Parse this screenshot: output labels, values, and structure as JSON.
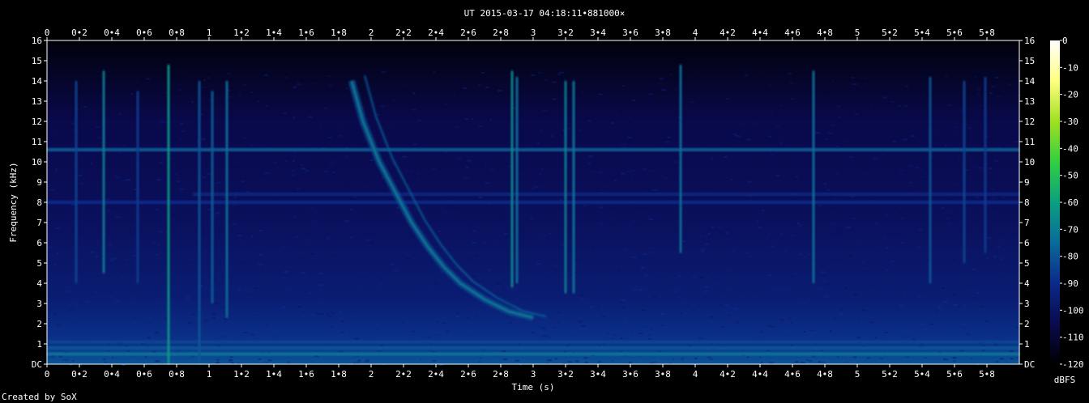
{
  "chart_data": {
    "type": "heatmap",
    "title": "UT 2015-03-17 04:18:11•881000×",
    "xlabel": "Time (s)",
    "ylabel": "Frequency (kHz)",
    "colorbar_label": "dBFS",
    "footer": "Created by SoX",
    "xlim": [
      0,
      6.0
    ],
    "ylim": [
      0,
      16
    ],
    "x_ticks": [
      "0",
      "0•2",
      "0•4",
      "0•6",
      "0•8",
      "1",
      "1•2",
      "1•4",
      "1•6",
      "1•8",
      "2",
      "2•2",
      "2•4",
      "2•6",
      "2•8",
      "3",
      "3•2",
      "3•4",
      "3•6",
      "3•8",
      "4",
      "4•2",
      "4•4",
      "4•6",
      "4•8",
      "5",
      "5•2",
      "5•4",
      "5•6",
      "5•8"
    ],
    "y_ticks": [
      "DC",
      "1",
      "2",
      "3",
      "4",
      "5",
      "6",
      "7",
      "8",
      "9",
      "10",
      "11",
      "12",
      "13",
      "14",
      "15",
      "16"
    ],
    "colorbar_ticks": [
      "0",
      "-10",
      "-20",
      "-30",
      "-40",
      "-50",
      "-60",
      "-70",
      "-80",
      "-90",
      "-100",
      "-110",
      "-120"
    ],
    "colorbar_range": [
      -120,
      0
    ],
    "colors": {
      "background": "#000000",
      "text": "#ffffff",
      "noise_floor": "#0a1a66",
      "strong": "#2fd6a8"
    },
    "colormap": [
      "#000000",
      "#0a0a50",
      "#0a2a8a",
      "#0a6a9a",
      "#0aa080",
      "#30d040",
      "#a0e020",
      "#ffff80",
      "#ffffff"
    ],
    "features": {
      "horizontal_lines": [
        {
          "freq_khz": 10.6,
          "level_db": -78,
          "t_start": 0,
          "t_end": 6
        },
        {
          "freq_khz": 8.4,
          "level_db": -92,
          "t_start": 0.9,
          "t_end": 6
        },
        {
          "freq_khz": 8.0,
          "level_db": -90,
          "t_start": 0,
          "t_end": 6
        },
        {
          "freq_khz": 0.5,
          "level_db": -72,
          "t_start": 0,
          "t_end": 6
        },
        {
          "freq_khz": 0.8,
          "level_db": -80,
          "t_start": 0,
          "t_end": 6
        },
        {
          "freq_khz": 1.1,
          "level_db": -84,
          "t_start": 0,
          "t_end": 6
        }
      ],
      "vertical_impulses": [
        {
          "t": 0.18,
          "f_low": 4,
          "f_high": 14,
          "level_db": -84
        },
        {
          "t": 0.35,
          "f_low": 4.5,
          "f_high": 14.5,
          "level_db": -70
        },
        {
          "t": 0.56,
          "f_low": 4,
          "f_high": 13.5,
          "level_db": -86
        },
        {
          "t": 0.75,
          "f_low": 0,
          "f_high": 14.8,
          "level_db": -62
        },
        {
          "t": 0.94,
          "f_low": 0,
          "f_high": 14,
          "level_db": -80
        },
        {
          "t": 1.02,
          "f_low": 3,
          "f_high": 13.5,
          "level_db": -78
        },
        {
          "t": 1.11,
          "f_low": 2.3,
          "f_high": 14,
          "level_db": -74
        },
        {
          "t": 2.87,
          "f_low": 3.8,
          "f_high": 14.5,
          "level_db": -66
        },
        {
          "t": 2.9,
          "f_low": 4,
          "f_high": 14.2,
          "level_db": -74
        },
        {
          "t": 3.2,
          "f_low": 3.5,
          "f_high": 14,
          "level_db": -70
        },
        {
          "t": 3.25,
          "f_low": 3.5,
          "f_high": 14,
          "level_db": -72
        },
        {
          "t": 3.91,
          "f_low": 5.5,
          "f_high": 14.8,
          "level_db": -74
        },
        {
          "t": 4.73,
          "f_low": 4,
          "f_high": 14.5,
          "level_db": -74
        },
        {
          "t": 5.45,
          "f_low": 4,
          "f_high": 14.2,
          "level_db": -80
        },
        {
          "t": 5.66,
          "f_low": 5,
          "f_high": 14,
          "level_db": -84
        },
        {
          "t": 5.79,
          "f_low": 5.5,
          "f_high": 14.2,
          "level_db": -86
        }
      ],
      "whistler": [
        {
          "t": 1.88,
          "f_khz": 14.0
        },
        {
          "t": 1.95,
          "f_khz": 12.0
        },
        {
          "t": 2.05,
          "f_khz": 10.0
        },
        {
          "t": 2.15,
          "f_khz": 8.5
        },
        {
          "t": 2.25,
          "f_khz": 7.0
        },
        {
          "t": 2.35,
          "f_khz": 5.8
        },
        {
          "t": 2.45,
          "f_khz": 4.8
        },
        {
          "t": 2.55,
          "f_khz": 4.0
        },
        {
          "t": 2.7,
          "f_khz": 3.2
        },
        {
          "t": 2.85,
          "f_khz": 2.6
        },
        {
          "t": 3.0,
          "f_khz": 2.3
        }
      ]
    }
  }
}
